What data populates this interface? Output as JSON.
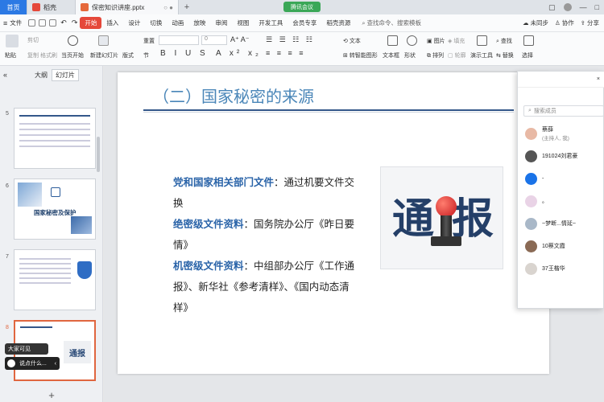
{
  "tabs": {
    "home": "首页",
    "wps": "稻壳",
    "doc": "保密知识讲座.pptx",
    "meeting": "腾讯会议"
  },
  "menu": {
    "file": "文件",
    "items": [
      "开始",
      "插入",
      "设计",
      "切换",
      "动画",
      "放映",
      "审阅",
      "视图",
      "开发工具",
      "会员专享",
      "稻壳资源"
    ],
    "search": "查找命令、搜索模板",
    "right": [
      "未同步",
      "协作",
      "分享"
    ]
  },
  "ribbon": {
    "paste": "粘贴",
    "cut": "剪切",
    "copy": "复制",
    "format": "格式刷",
    "from_current": "当页开始",
    "new_slide": "新建幻灯片",
    "layout": "版式",
    "section": "节",
    "reset": "重置",
    "font_size": "0",
    "textbox_a": "文本框",
    "shape": "形状",
    "arrange": "排列",
    "outline": "轮廓",
    "picture": "图片",
    "fill": "填充",
    "present_tools": "演示工具",
    "find": "查找",
    "replace": "替换",
    "select": "选择",
    "convert_smartart": "转智能图形",
    "text_style": "文本"
  },
  "left_panel": {
    "tab_outline": "大纲",
    "tab_slides": "幻灯片",
    "slide_numbers": [
      "5",
      "6",
      "7",
      "8"
    ],
    "thumb6_title": "国家秘密及保护"
  },
  "slide": {
    "title": "（二）国家秘密的来源",
    "lines": [
      {
        "label": "党和国家相关部门文件",
        "text": "：通过机要文件交换"
      },
      {
        "label": "绝密级文件资料",
        "text": "：国务院办公厅《昨日要情》"
      },
      {
        "label": "机密级文件资料",
        "text": "：中组部办公厅《工作通报》、新华社《参考清样》、《国内动态清样》"
      }
    ],
    "image_text_1": "通",
    "image_text_2": "报"
  },
  "popup": {
    "header": "",
    "search_placeholder": "搜索成员",
    "members": [
      {
        "name": "蔡薛",
        "sub": "(主持人, 我)"
      },
      {
        "name": "191024刘君豪",
        "sub": ""
      },
      {
        "name": "-",
        "sub": ""
      },
      {
        "name": "。",
        "sub": ""
      },
      {
        "name": "~梦断...情延~",
        "sub": ""
      },
      {
        "name": "10蔡文霞",
        "sub": ""
      },
      {
        "name": "37王楷华",
        "sub": ""
      }
    ]
  },
  "floating": {
    "bubble": "大家可见",
    "chat": "说点什么..."
  },
  "colors": {
    "accent": "#e5483a",
    "title_blue": "#4a86b8",
    "highlight_blue": "#2963a8",
    "meeting_green": "#3aa757"
  }
}
